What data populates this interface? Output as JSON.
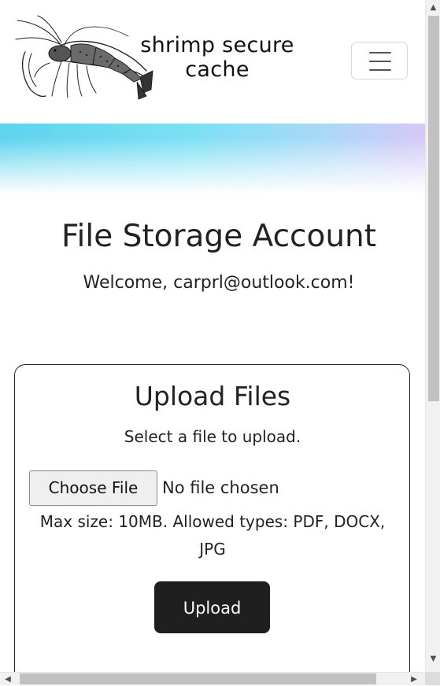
{
  "header": {
    "brand_line1": "shrimp secure",
    "brand_line2": "cache",
    "logo_icon": "shrimp-logo-icon",
    "menu_icon": "hamburger-menu-icon"
  },
  "main": {
    "title": "File Storage Account",
    "welcome": "Welcome, carprl@outlook.com!"
  },
  "upload_card": {
    "title": "Upload Files",
    "subtitle": "Select a file to upload.",
    "choose_file_label": "Choose File",
    "file_status": "No file chosen",
    "hint": "Max size: 10MB. Allowed types: PDF, DOCX, JPG",
    "upload_label": "Upload"
  },
  "colors": {
    "gradient_start": "#5fd3ee",
    "gradient_end": "#d6c8f7",
    "button_dark": "#1f1f1f"
  }
}
